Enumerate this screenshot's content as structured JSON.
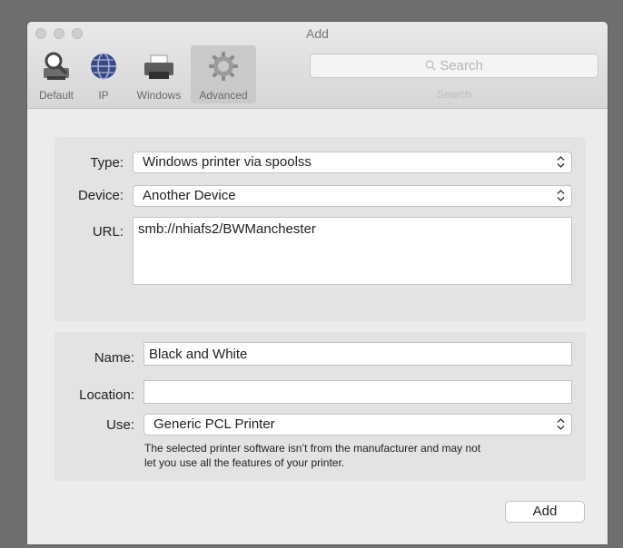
{
  "window": {
    "title": "Add"
  },
  "toolbar": {
    "default_label": "Default",
    "ip_label": "IP",
    "windows_label": "Windows",
    "advanced_label": "Advanced",
    "active_tab": "Advanced"
  },
  "search": {
    "placeholder": "Search",
    "label": "Search"
  },
  "connection": {
    "type_label": "Type:",
    "type_value": "Windows printer via spoolss",
    "device_label": "Device:",
    "device_value": "Another Device",
    "url_label": "URL:",
    "url_value": "smb://nhiafs2/BWManchester"
  },
  "printer": {
    "name_label": "Name:",
    "name_value": "Black and White",
    "location_label": "Location:",
    "location_value": "",
    "use_label": "Use:",
    "use_value": "Generic PCL Printer",
    "note_line1": "The selected printer software isn’t from the manufacturer and may not",
    "note_line2": "let you use all the features of your printer."
  },
  "footer": {
    "add_label": "Add"
  }
}
